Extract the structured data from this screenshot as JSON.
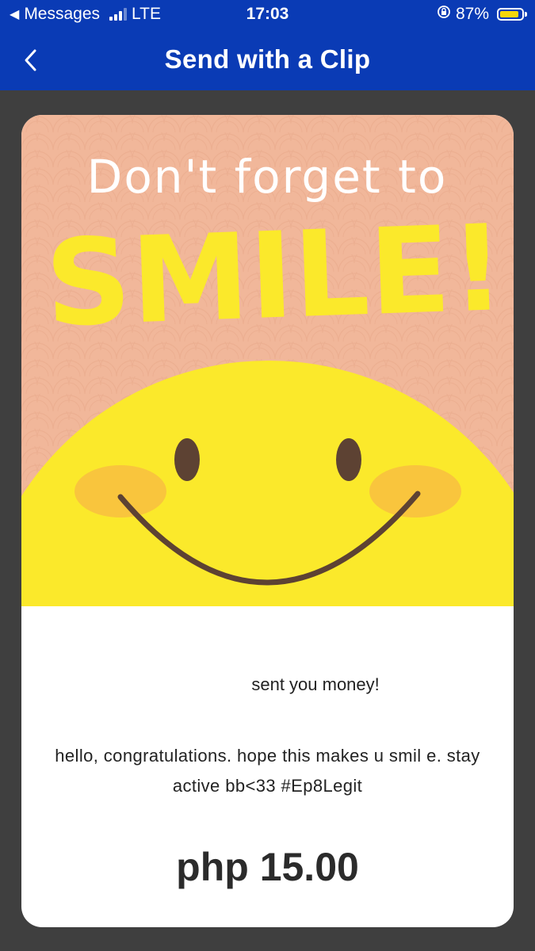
{
  "status_bar": {
    "back_app": "Messages",
    "network": "LTE",
    "time": "17:03",
    "battery": "87%",
    "battery_level": 0.87
  },
  "header": {
    "title": "Send with a Clip",
    "back_icon": "chevron-left-icon"
  },
  "card": {
    "art": {
      "line1": "Don't forget to",
      "line2": "SMILE!"
    },
    "sender_suffix": "sent you money!",
    "message": "hello, congratulations. hope this makes u smil e. stay active bb<33 #Ep8Legit",
    "amount": "php 15.00"
  },
  "colors": {
    "brand_blue": "#0a3bb5",
    "card_peach": "#f1b79a",
    "smiley_yellow": "#fbe92b",
    "cheek": "#f9c53d",
    "feature_brown": "#5d4233"
  }
}
